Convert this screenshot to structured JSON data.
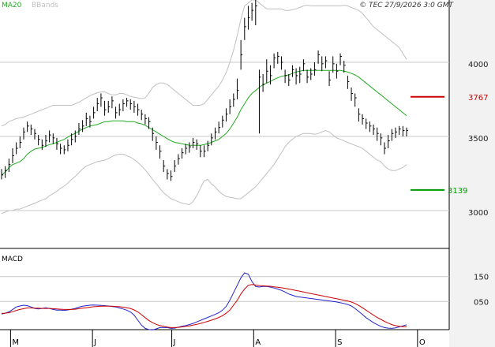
{
  "header": {
    "legend_ma": "MA20",
    "legend_bb": "BBands",
    "copyright": "© TEC 27/9/2026 3:0 GMT"
  },
  "colors": {
    "candle": "#000000",
    "ma": "#22aa22",
    "bbands": "#c0c0c0",
    "grid": "#c8c8c8",
    "resistance": "#cc0000",
    "support": "#009900",
    "macd_line": "#2222cc",
    "signal_line": "#cc0000",
    "axis_bg": "#f2f2f2"
  },
  "chart_data": [
    {
      "type": "candlestick",
      "ylim": [
        2750,
        4420
      ],
      "yticks": [
        3000,
        3500,
        4000
      ],
      "ytick_labels": [
        "3000",
        "3500",
        "4000"
      ],
      "resistance": {
        "value": 3767,
        "label": "3767"
      },
      "support": {
        "value": 3139,
        "label": "3139"
      },
      "xlabels": [
        "M",
        "J",
        "J",
        "A",
        "S",
        "O"
      ],
      "xlabel_days": [
        4,
        35,
        65,
        96,
        127,
        158
      ],
      "x_days_range": [
        0,
        170
      ],
      "series": {
        "close": [
          3240,
          3270,
          3310,
          3370,
          3420,
          3460,
          3530,
          3570,
          3550,
          3520,
          3480,
          3440,
          3470,
          3510,
          3490,
          3450,
          3420,
          3410,
          3440,
          3480,
          3500,
          3550,
          3570,
          3620,
          3600,
          3660,
          3720,
          3760,
          3680,
          3700,
          3740,
          3660,
          3680,
          3720,
          3740,
          3720,
          3700,
          3680,
          3650,
          3620,
          3600,
          3520,
          3460,
          3400,
          3300,
          3250,
          3230,
          3300,
          3350,
          3390,
          3420,
          3430,
          3460,
          3450,
          3400,
          3400,
          3440,
          3490,
          3530,
          3560,
          3610,
          3650,
          3700,
          3750,
          3810,
          4050,
          4240,
          4300,
          4350,
          4380,
          3900,
          3850,
          3940,
          3910,
          4030,
          4040,
          4000,
          3910,
          3880,
          3950,
          3910,
          3920,
          3990,
          3900,
          3920,
          3950,
          4050,
          3990,
          4010,
          3880,
          3990,
          3940,
          4040,
          3980,
          3870,
          3790,
          3760,
          3650,
          3620,
          3590,
          3570,
          3550,
          3520,
          3490,
          3420,
          3470,
          3520,
          3530,
          3550,
          3540,
          3540
        ],
        "high": [
          3280,
          3300,
          3350,
          3420,
          3460,
          3500,
          3560,
          3600,
          3580,
          3550,
          3510,
          3480,
          3510,
          3540,
          3520,
          3490,
          3450,
          3440,
          3480,
          3520,
          3540,
          3590,
          3610,
          3660,
          3640,
          3700,
          3760,
          3790,
          3740,
          3740,
          3770,
          3700,
          3720,
          3750,
          3760,
          3750,
          3740,
          3720,
          3680,
          3650,
          3630,
          3560,
          3500,
          3440,
          3340,
          3280,
          3270,
          3340,
          3380,
          3420,
          3450,
          3460,
          3490,
          3480,
          3440,
          3440,
          3470,
          3520,
          3560,
          3600,
          3640,
          3690,
          3750,
          3790,
          3890,
          4150,
          4300,
          4380,
          4400,
          4420,
          3950,
          3920,
          4020,
          3980,
          4060,
          4070,
          4040,
          3950,
          3920,
          3980,
          3960,
          3970,
          4020,
          3950,
          3960,
          4000,
          4080,
          4040,
          4040,
          3940,
          4040,
          3990,
          4060,
          4010,
          3910,
          3830,
          3790,
          3690,
          3650,
          3620,
          3600,
          3580,
          3560,
          3520,
          3460,
          3510,
          3550,
          3560,
          3570,
          3570,
          3560
        ],
        "low": [
          3210,
          3220,
          3260,
          3320,
          3380,
          3420,
          3480,
          3530,
          3510,
          3480,
          3440,
          3410,
          3430,
          3460,
          3450,
          3410,
          3380,
          3380,
          3400,
          3440,
          3460,
          3510,
          3530,
          3570,
          3560,
          3620,
          3670,
          3700,
          3640,
          3660,
          3690,
          3620,
          3640,
          3670,
          3700,
          3680,
          3660,
          3640,
          3610,
          3580,
          3550,
          3470,
          3410,
          3350,
          3260,
          3210,
          3200,
          3260,
          3310,
          3350,
          3380,
          3390,
          3420,
          3410,
          3360,
          3360,
          3400,
          3440,
          3480,
          3520,
          3560,
          3600,
          3650,
          3700,
          3750,
          3950,
          4150,
          4220,
          4280,
          4250,
          3520,
          3800,
          3860,
          3850,
          3960,
          3990,
          3950,
          3860,
          3840,
          3900,
          3850,
          3860,
          3940,
          3860,
          3880,
          3910,
          3990,
          3940,
          3960,
          3840,
          3930,
          3890,
          3980,
          3930,
          3820,
          3740,
          3700,
          3600,
          3580,
          3550,
          3530,
          3510,
          3470,
          3440,
          3380,
          3420,
          3470,
          3490,
          3510,
          3500,
          3500
        ],
        "ma20": [
          3240,
          3260,
          3290,
          3310,
          3320,
          3330,
          3350,
          3380,
          3400,
          3415,
          3420,
          3425,
          3435,
          3445,
          3450,
          3460,
          3470,
          3480,
          3495,
          3510,
          3520,
          3535,
          3550,
          3560,
          3570,
          3575,
          3580,
          3590,
          3600,
          3600,
          3605,
          3605,
          3605,
          3605,
          3600,
          3600,
          3600,
          3590,
          3585,
          3575,
          3560,
          3545,
          3530,
          3515,
          3500,
          3485,
          3470,
          3460,
          3455,
          3450,
          3445,
          3440,
          3440,
          3440,
          3440,
          3445,
          3450,
          3460,
          3470,
          3480,
          3500,
          3520,
          3550,
          3590,
          3630,
          3680,
          3720,
          3760,
          3790,
          3810,
          3830,
          3850,
          3860,
          3870,
          3885,
          3895,
          3905,
          3910,
          3915,
          3925,
          3935,
          3940,
          3945,
          3945,
          3945,
          3945,
          3945,
          3945,
          3945,
          3945,
          3945,
          3945,
          3945,
          3940,
          3935,
          3925,
          3915,
          3900,
          3880,
          3860,
          3840,
          3820,
          3800,
          3780,
          3760,
          3740,
          3720,
          3700,
          3680,
          3660,
          3640
        ],
        "bb_upper": [
          3570,
          3580,
          3600,
          3610,
          3620,
          3625,
          3630,
          3640,
          3650,
          3660,
          3670,
          3680,
          3690,
          3700,
          3710,
          3710,
          3710,
          3710,
          3710,
          3710,
          3720,
          3730,
          3745,
          3760,
          3775,
          3785,
          3795,
          3800,
          3800,
          3790,
          3780,
          3780,
          3790,
          3790,
          3780,
          3770,
          3765,
          3760,
          3755,
          3760,
          3790,
          3830,
          3850,
          3860,
          3860,
          3850,
          3830,
          3810,
          3790,
          3770,
          3750,
          3730,
          3710,
          3710,
          3710,
          3720,
          3750,
          3780,
          3810,
          3840,
          3880,
          3930,
          4000,
          4080,
          4180,
          4290,
          4380,
          4400,
          4420,
          4420,
          4400,
          4380,
          4360,
          4360,
          4360,
          4360,
          4360,
          4350,
          4350,
          4355,
          4360,
          4370,
          4380,
          4385,
          4380,
          4380,
          4380,
          4380,
          4380,
          4380,
          4380,
          4380,
          4380,
          4385,
          4380,
          4370,
          4360,
          4350,
          4330,
          4300,
          4270,
          4240,
          4220,
          4200,
          4180,
          4160,
          4140,
          4120,
          4100,
          4060,
          4020
        ],
        "bb_lower": [
          2980,
          2990,
          3000,
          3000,
          3010,
          3010,
          3020,
          3030,
          3040,
          3050,
          3060,
          3070,
          3080,
          3100,
          3115,
          3130,
          3150,
          3165,
          3185,
          3210,
          3230,
          3255,
          3280,
          3300,
          3310,
          3320,
          3330,
          3335,
          3340,
          3350,
          3365,
          3375,
          3380,
          3380,
          3370,
          3360,
          3345,
          3325,
          3300,
          3275,
          3245,
          3210,
          3180,
          3150,
          3120,
          3100,
          3080,
          3070,
          3060,
          3050,
          3045,
          3040,
          3060,
          3100,
          3150,
          3200,
          3210,
          3180,
          3160,
          3130,
          3110,
          3095,
          3090,
          3085,
          3080,
          3080,
          3100,
          3120,
          3140,
          3160,
          3190,
          3220,
          3250,
          3280,
          3310,
          3350,
          3390,
          3430,
          3460,
          3480,
          3500,
          3510,
          3520,
          3520,
          3520,
          3515,
          3520,
          3530,
          3540,
          3530,
          3510,
          3490,
          3480,
          3470,
          3460,
          3450,
          3440,
          3430,
          3420,
          3400,
          3380,
          3360,
          3340,
          3330,
          3300,
          3280,
          3270,
          3270,
          3280,
          3290,
          3310
        ]
      }
    },
    {
      "type": "line",
      "title": "MACD",
      "ylim": [
        -60,
        260
      ],
      "yticks": [
        50,
        150
      ],
      "ytick_labels": [
        "050",
        "150"
      ],
      "x_days_range": [
        0,
        170
      ],
      "series": [
        {
          "role": "macd",
          "values": [
            0,
            3,
            8,
            18,
            28,
            32,
            35,
            33,
            28,
            22,
            20,
            22,
            25,
            22,
            18,
            15,
            15,
            14,
            16,
            19,
            22,
            27,
            31,
            33,
            35,
            36,
            35,
            34,
            33,
            32,
            30,
            28,
            24,
            20,
            15,
            8,
            -5,
            -25,
            -45,
            -58,
            -63,
            -64,
            -60,
            -55,
            -55,
            -55,
            -58,
            -57,
            -53,
            -50,
            -47,
            -43,
            -38,
            -32,
            -26,
            -20,
            -14,
            -8,
            -2,
            5,
            15,
            30,
            55,
            85,
            115,
            145,
            165,
            160,
            130,
            110,
            108,
            110,
            110,
            108,
            104,
            100,
            95,
            88,
            80,
            75,
            70,
            68,
            66,
            64,
            62,
            60,
            58,
            56,
            54,
            52,
            50,
            48,
            45,
            42,
            38,
            32,
            22,
            10,
            -2,
            -15,
            -25,
            -35,
            -43,
            -50,
            -55,
            -57,
            -58,
            -56,
            -52,
            -48,
            -44
          ]
        },
        {
          "role": "signal",
          "values": [
            2,
            3,
            5,
            9,
            14,
            18,
            21,
            24,
            24,
            23,
            23,
            22,
            22,
            22,
            21,
            20,
            19,
            18,
            18,
            18,
            19,
            21,
            23,
            25,
            27,
            29,
            30,
            31,
            31,
            31,
            31,
            30,
            29,
            27,
            25,
            22,
            16,
            8,
            -3,
            -15,
            -26,
            -35,
            -42,
            -47,
            -50,
            -53,
            -55,
            -55,
            -54,
            -52,
            -50,
            -48,
            -45,
            -42,
            -38,
            -34,
            -30,
            -25,
            -20,
            -14,
            -7,
            3,
            15,
            35,
            55,
            80,
            100,
            115,
            118,
            116,
            114,
            113,
            112,
            111,
            109,
            107,
            105,
            103,
            100,
            97,
            94,
            91,
            88,
            85,
            82,
            79,
            76,
            73,
            70,
            67,
            64,
            61,
            58,
            55,
            52,
            48,
            42,
            34,
            25,
            15,
            5,
            -5,
            -14,
            -22,
            -30,
            -37,
            -43,
            -47,
            -50,
            -51,
            -51
          ]
        }
      ]
    }
  ]
}
